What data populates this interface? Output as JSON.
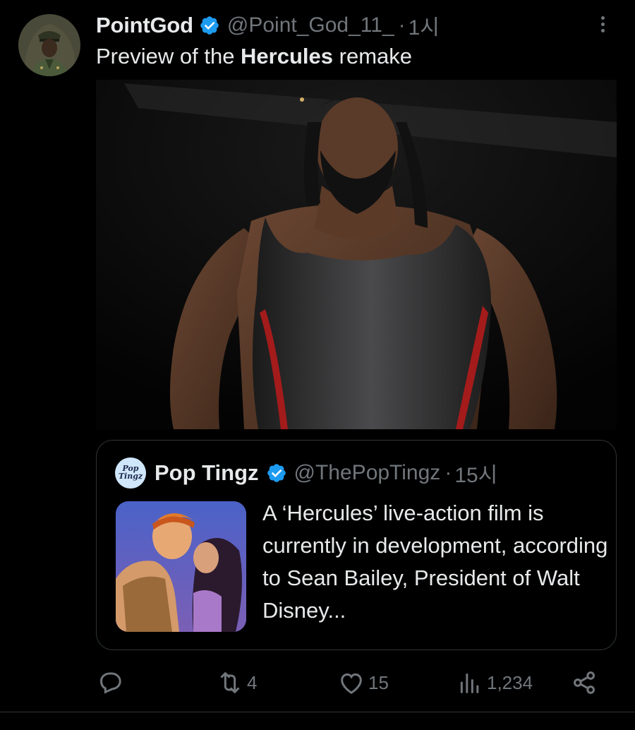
{
  "tweet": {
    "author_name": "PointGod",
    "handle": "@Point_God_11_",
    "separator": "·",
    "time": "1시",
    "text_before": "Preview of the ",
    "text_bold": "Hercules",
    "text_after": " remake",
    "media_alt": "Man with long braided hair and beard wearing a black singlet with red stripes"
  },
  "quote": {
    "author_name": "Pop Tingz",
    "avatar_text": "Pop Tingz",
    "handle": "@ThePopTingz",
    "separator": "·",
    "time": "15시",
    "text": "A ‘Hercules’ live-action film is currently in development, according to Sean Bailey, President of Walt Disney..."
  },
  "actions": {
    "reply_count": "",
    "retweet_count": "4",
    "like_count": "15",
    "view_count": "1,234"
  },
  "colors": {
    "background": "#000000",
    "text_primary": "#e7e9ea",
    "text_secondary": "#71767b",
    "verified_blue": "#1d9bf0",
    "border": "#2f3336"
  },
  "icons": [
    "verified-badge-icon",
    "more-options-icon",
    "reply-icon",
    "retweet-icon",
    "like-icon",
    "views-icon",
    "share-icon"
  ]
}
